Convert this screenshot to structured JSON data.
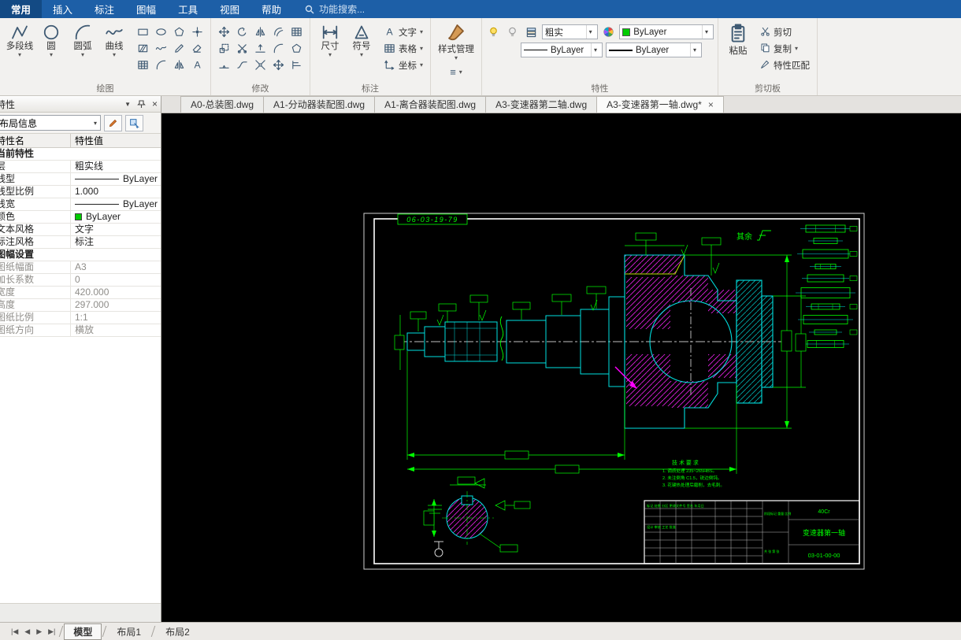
{
  "menubar": {
    "tabs": [
      {
        "label": "常用",
        "active": true
      },
      {
        "label": "插入",
        "active": false
      },
      {
        "label": "标注",
        "active": false
      },
      {
        "label": "图幅",
        "active": false
      },
      {
        "label": "工具",
        "active": false
      },
      {
        "label": "视图",
        "active": false
      },
      {
        "label": "帮助",
        "active": false
      }
    ],
    "search_text": "功能搜索..."
  },
  "ribbon": {
    "groups": {
      "draw": "绘图",
      "modify": "修改",
      "annotate": "标注",
      "properties": "特性",
      "clipboard": "剪切板"
    },
    "draw_big": [
      {
        "label": "多段线",
        "icon": {
          "name": "polyline-icon",
          "shape": "polyline"
        }
      },
      {
        "label": "圆",
        "icon": {
          "name": "circle-icon",
          "shape": "circle"
        }
      },
      {
        "label": "圆弧",
        "icon": {
          "name": "arc-icon",
          "shape": "arc"
        }
      },
      {
        "label": "曲线",
        "icon": {
          "name": "curve-icon",
          "shape": "wave"
        }
      }
    ],
    "draw_small": [
      {
        "name": "rectangle-icon",
        "shape": "rect"
      },
      {
        "name": "ellipse-icon",
        "shape": "ellipse"
      },
      {
        "name": "polygon-icon",
        "shape": "polygon"
      },
      {
        "name": "point-icon",
        "shape": "point"
      },
      {
        "name": "hatch-icon",
        "shape": "hatch"
      },
      {
        "name": "spline-icon",
        "shape": "wave"
      },
      {
        "name": "sketch-icon",
        "shape": "pencil"
      },
      {
        "name": "eraser-icon",
        "shape": "erase"
      },
      {
        "name": "table-icon",
        "shape": "grid"
      },
      {
        "name": "arc-small-icon",
        "shape": "arc"
      },
      {
        "name": "mirror-line-icon",
        "shape": "mirror"
      },
      {
        "name": "text-small-icon",
        "shape": "text"
      }
    ],
    "modify_small": [
      {
        "name": "move-icon",
        "shape": "move"
      },
      {
        "name": "rotate-icon",
        "shape": "rotate"
      },
      {
        "name": "mirror-icon",
        "shape": "mirror"
      },
      {
        "name": "offset-icon",
        "shape": "offset"
      },
      {
        "name": "array-icon",
        "shape": "grid"
      },
      {
        "name": "scale-icon",
        "shape": "scale"
      },
      {
        "name": "trim-icon",
        "shape": "trim"
      },
      {
        "name": "extend-icon",
        "shape": "extend"
      },
      {
        "name": "fillet-icon",
        "shape": "arc"
      },
      {
        "name": "chamfer-icon",
        "shape": "polygon"
      },
      {
        "name": "break-icon",
        "shape": "break"
      },
      {
        "name": "join-icon",
        "shape": "join"
      },
      {
        "name": "explode-icon",
        "shape": "explode"
      },
      {
        "name": "stretch-icon",
        "shape": "move"
      },
      {
        "name": "align-icon",
        "shape": "align"
      }
    ],
    "annotate_big": [
      {
        "label": "尺寸",
        "icon": {
          "name": "dimension-icon",
          "shape": "dimension"
        }
      },
      {
        "label": "符号",
        "icon": {
          "name": "symbol-icon",
          "shape": "symbol"
        }
      }
    ],
    "annotate_small": [
      {
        "label": "文字",
        "icon": {
          "name": "text-icon",
          "shape": "text"
        }
      },
      {
        "label": "表格",
        "icon": {
          "name": "table-icon",
          "shape": "grid"
        }
      },
      {
        "label": "坐标",
        "icon": {
          "name": "coordinate-icon",
          "shape": "coord"
        }
      }
    ],
    "style_manager": {
      "label": "样式管理",
      "icon": {
        "name": "style-manager-icon",
        "shape": "brush"
      }
    },
    "properties": {
      "layer_combo": "粗实",
      "color_combo": "ByLayer",
      "color_swatch": "#00cc00",
      "linetype_combo": "ByLayer",
      "lineweight_combo": "ByLayer"
    },
    "clipboard": {
      "paste": "粘贴",
      "cut": "剪切",
      "copy": "复制",
      "match": "特性匹配"
    }
  },
  "doc_tabs": [
    {
      "label": "A0-总装图.dwg",
      "active": false
    },
    {
      "label": "A1-分动器装配图.dwg",
      "active": false
    },
    {
      "label": "A1-离合器装配图.dwg",
      "active": false
    },
    {
      "label": "A3-变速器第二轴.dwg",
      "active": false
    },
    {
      "label": "A3-变速器第一轴.dwg*",
      "active": true,
      "close": "×"
    }
  ],
  "properties_panel": {
    "title": "特性",
    "selector_value": "布局信息",
    "columns": {
      "name": "特性名",
      "value": "特性值"
    },
    "rows": [
      {
        "type": "section",
        "name": "当前特性"
      },
      {
        "name": "层",
        "value": "粗实线"
      },
      {
        "name": "线型",
        "value": "ByLayer",
        "line": true
      },
      {
        "name": "线型比例",
        "value": "1.000"
      },
      {
        "name": "线宽",
        "value": "ByLayer",
        "line": true
      },
      {
        "name": "颜色",
        "value": "ByLayer",
        "swatch": "#00cc00"
      },
      {
        "name": "文本风格",
        "value": "文字"
      },
      {
        "name": "标注风格",
        "value": "标注"
      },
      {
        "type": "section",
        "name": "图幅设置"
      },
      {
        "name": "图纸幅面",
        "value": "A3",
        "muted": true
      },
      {
        "name": "加长系数",
        "value": "0",
        "muted": true
      },
      {
        "name": "宽度",
        "value": "420.000",
        "muted": true
      },
      {
        "name": "高度",
        "value": "297.000",
        "muted": true
      },
      {
        "name": "图纸比例",
        "value": "1:1",
        "muted": true
      },
      {
        "name": "图纸方向",
        "value": "横放",
        "muted": true
      }
    ]
  },
  "drawing": {
    "frame_code": "06-03-19-79",
    "finish_label": "其余",
    "tech_title": "技 术 要 求",
    "tech_notes": [
      "1. 调质处理 235~265HBS。",
      "2. 未注倒角 C1.5，锐边倒钝。",
      "3. 花键热处理后磨削，去毛刺。"
    ],
    "title_block": {
      "material": "40Cr",
      "part_name": "变速器第一轴",
      "drawing_no": "03-01-00-00",
      "header_row": "标记 处数 分区 更改文件号 签名 年月日",
      "sign_rows": "设计  审核  工艺  批准",
      "stage_row": "阶段标记 重量 比例",
      "sheet_row": "共 张 第 张"
    }
  },
  "status_bar": {
    "nav": [
      "|◀",
      "◀",
      "▶",
      "▶|"
    ],
    "tabs": [
      {
        "label": "模型",
        "active": true
      },
      {
        "label": "布局1",
        "active": false
      },
      {
        "label": "布局2",
        "active": false
      }
    ]
  }
}
